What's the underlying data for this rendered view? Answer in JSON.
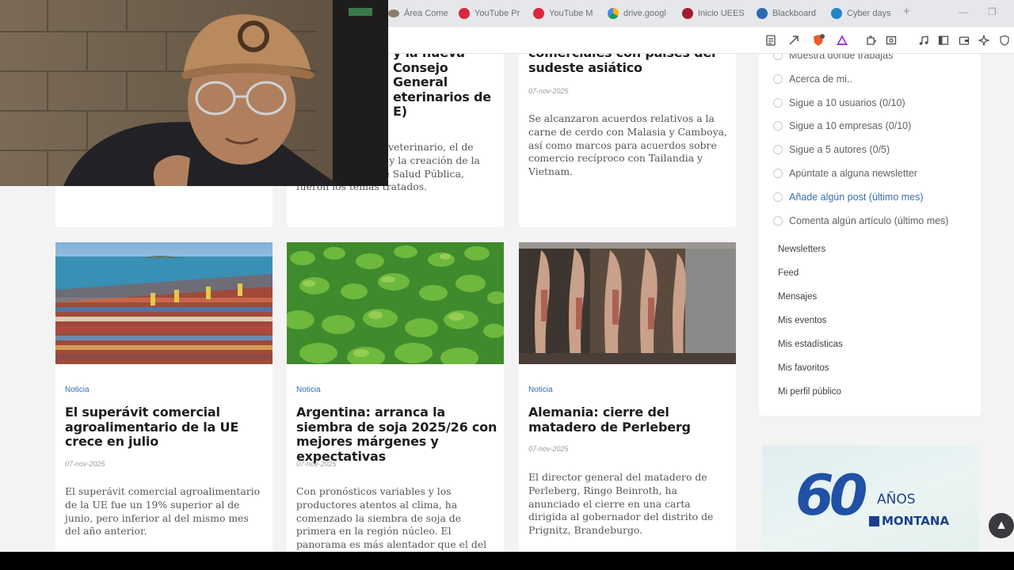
{
  "browser": {
    "tabs": [
      {
        "title": "Área Come",
        "color": "#8b7f6a"
      },
      {
        "title": "YouTube Pr",
        "color": "#d9283b"
      },
      {
        "title": "YouTube M",
        "color": "#d9283b"
      },
      {
        "title": "drive.googl",
        "color": "#3b8c55"
      },
      {
        "title": "Inicio UEES",
        "color": "#a01c34"
      },
      {
        "title": "Blackboard",
        "color": "#2b6cb0"
      },
      {
        "title": "Cyber days",
        "color": "#1e88c8"
      }
    ],
    "new_tab": "+",
    "minimize": "—",
    "restore": "❐"
  },
  "cards_top": [
    {
      "title_lines": [
        "y la nueva",
        "Consejo General",
        "eterinarios de",
        "E)"
      ],
      "excerpt": "veterinario, el de Medicamentos y s y la creación de la Agencia Estatal de Salud Pública, fueron los temas tratados."
    },
    {
      "title_lines": [
        "comerciales con países del",
        "sudeste asiático"
      ],
      "date": "07-nov-2025",
      "excerpt": "Se alcanzaron acuerdos relativos a la carne de cerdo con Malasia y Camboya, así como marcos para acuerdos sobre comercio recíproco con Tailandia y Vietnam."
    }
  ],
  "cards": [
    {
      "tag": "Noticia",
      "title": "El superávit comercial agroalimentario de la UE crece en julio",
      "date": "07-nov-2025",
      "excerpt": "El superávit comercial agroalimentario de la UE fue un 19% superior al de junio, pero inferior al del mismo mes del año anterior."
    },
    {
      "tag": "Noticia",
      "title": "Argentina: arranca la siembra de soja 2025/26 con mejores márgenes y expectativas",
      "date": "07-nov-2025",
      "excerpt": "Con pronósticos variables y los productores atentos al clima, ha comenzado la siembra de soja de primera en la región núcleo. El panorama es más alentador que el del año pasado en materia de márgenes, aunque"
    },
    {
      "tag": "Noticia",
      "title": "Alemania: cierre del matadero de Perleberg",
      "date": "07-nov-2025",
      "excerpt": "El director general del matadero de Perleberg, Ringo Beinroth, ha anunciado el cierre en una carta dirigida al gobernador del distrito de Prignitz, Brandeburgo."
    }
  ],
  "sidebar": {
    "tasks": [
      "Muestra dónde trabajas",
      "Acerca de mi..",
      "Sigue a 10 usuarios (0/10)",
      "Sigue a 10 empresas (0/10)",
      "Sigue a 5 autores (0/5)",
      "Apúntate a alguna newsletter",
      "Añade algún post (último mes)",
      "Comenta algún artículo (último mes)"
    ],
    "menu": [
      "Newsletters",
      "Feed",
      "Mensajes",
      "Mis eventos",
      "Mis estadísticas",
      "Mis favoritos",
      "Mi perfil público"
    ]
  },
  "ad": {
    "number": "60",
    "anos": "AÑOS",
    "brand": "MONTANA"
  },
  "scroll_top": "▲"
}
